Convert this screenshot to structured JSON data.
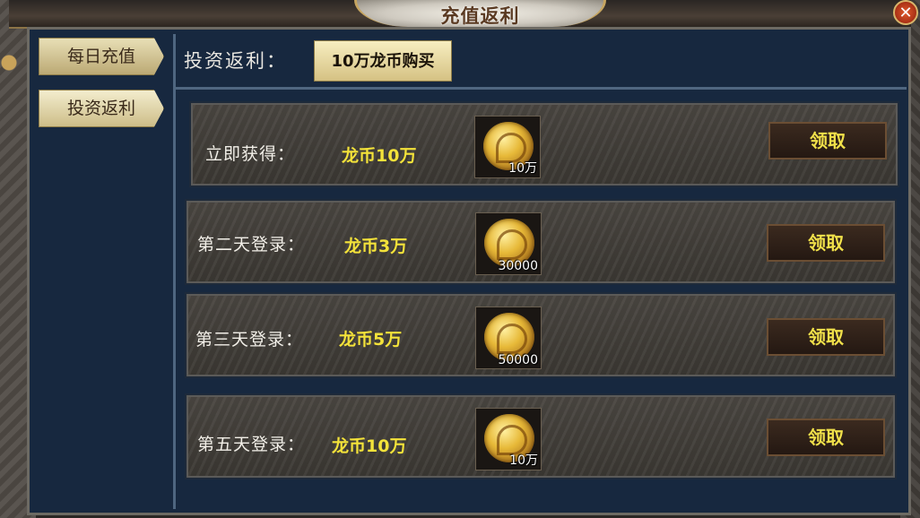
{
  "window": {
    "title": "充值返利",
    "close_label": "✕"
  },
  "sidebar": {
    "items": [
      {
        "label": "每日充值"
      },
      {
        "label": "投资返利"
      }
    ]
  },
  "header": {
    "label": "投资返利：",
    "buy_button": "10万龙币购买"
  },
  "rows": [
    {
      "label": "立即获得：",
      "value": "龙币10万",
      "coin_qty": "10万",
      "claim": "领取"
    },
    {
      "label": "第二天登录：",
      "value": "龙币3万",
      "coin_qty": "30000",
      "claim": "领取"
    },
    {
      "label": "第三天登录：",
      "value": "龙币5万",
      "coin_qty": "50000",
      "claim": "领取"
    },
    {
      "label": "第五天登录：",
      "value": "龙币10万",
      "coin_qty": "10万",
      "claim": "领取"
    }
  ],
  "icons": {
    "coin": "dragon-coin-icon",
    "close": "close-icon"
  }
}
